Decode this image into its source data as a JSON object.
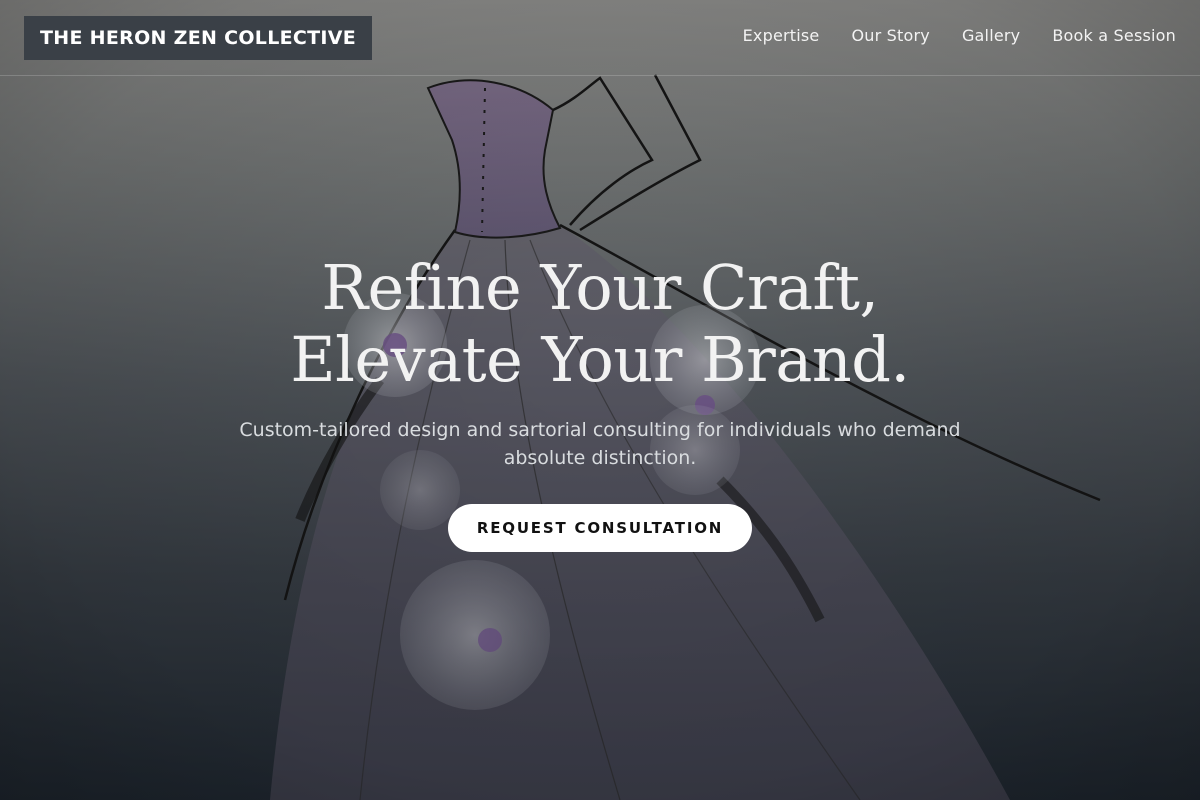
{
  "brand": {
    "name": "THE HERON ZEN COLLECTIVE"
  },
  "nav": {
    "links": [
      {
        "label": "Expertise"
      },
      {
        "label": "Our Story"
      },
      {
        "label": "Gallery"
      },
      {
        "label": "Book a Session"
      }
    ]
  },
  "hero": {
    "headline_line1": "Refine Your Craft,",
    "headline_line2": "Elevate Your Brand.",
    "subtext": "Custom-tailored design and sartorial consulting for individuals who demand absolute distinction.",
    "cta_label": "REQUEST CONSULTATION",
    "background_image": "gown-sketch-illustration"
  },
  "colors": {
    "logo_bg": "#3a4047",
    "cta_bg": "#ffffff",
    "text_light": "#f2f2f2"
  }
}
